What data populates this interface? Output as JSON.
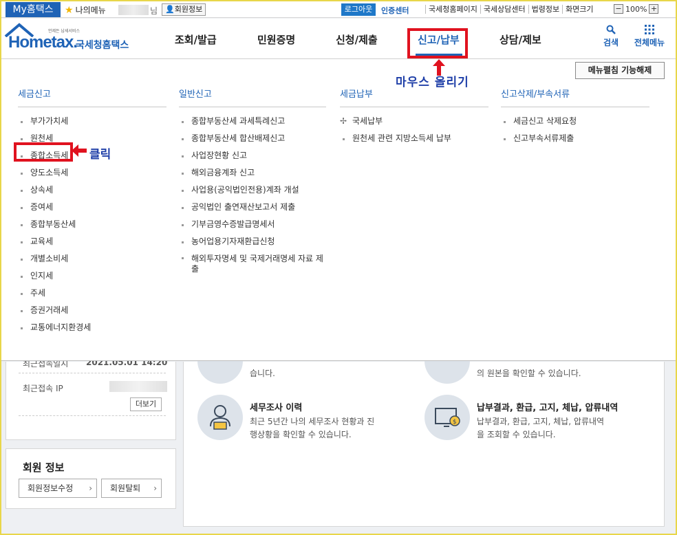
{
  "topbar": {
    "my_label": "My홈택스",
    "my_menu": "나의메뉴",
    "name_suffix": "님",
    "member_info": "회원정보",
    "logout": "로그아웃",
    "cert_center": "인증센터",
    "links": [
      "국세청홈페이지",
      "국세상담센터",
      "법령정보",
      "화면크기"
    ],
    "zoom_minus": "−",
    "zoom_value": "100%",
    "zoom_plus": "+"
  },
  "header": {
    "logo_sub": "언제든 납세서비스",
    "logo_text": "Hometax.",
    "logo_kr": "국세청홈택스",
    "nav": [
      "조회/발급",
      "민원증명",
      "신청/제출",
      "신고/납부",
      "상담/제보"
    ],
    "active_nav": "신고/납부",
    "search_label": "검색",
    "all_menu_label": "전체메뉴"
  },
  "mega": {
    "fold_button": "메뉴펼침 기능해제",
    "columns": [
      {
        "title": "세금신고",
        "items": [
          "부가가치세",
          "원천세",
          "종합소득세",
          "양도소득세",
          "상속세",
          "증여세",
          "종합부동산세",
          "교육세",
          "개별소비세",
          "인지세",
          "주세",
          "증권거래세",
          "교통에너지환경세"
        ]
      },
      {
        "title": "일반신고",
        "items": [
          "종합부동산세 과세특례신고",
          "종합부동산세 합산배제신고",
          "사업장현황 신고",
          "해외금융계좌 신고",
          "사업용(공익법인전용)계좌 개설",
          "공익법인 출연재산보고서 제출",
          "기부금영수증발급명세서",
          "농어업용기자재환급신청",
          "해외투자명세 및 국제거래명세 자료 제출"
        ]
      },
      {
        "title": "세금납부",
        "items": [
          "국세납부",
          "원천세 관련 지방소득세 납부"
        ]
      },
      {
        "title": "신고삭제/부속서류",
        "items": [
          "세금신고 삭제요청",
          "신고부속서류제출"
        ]
      }
    ]
  },
  "annotations": {
    "hover": "마우스 올리기",
    "click": "클릭"
  },
  "leftpanel": {
    "last_login_label": "최근접속일시",
    "last_login_value": "2021.05.01 14:20",
    "last_ip_label": "최근접속 IP",
    "more": "더보기"
  },
  "member_panel": {
    "title": "회원 정보",
    "edit": "회원정보수정",
    "withdraw": "회원탈퇴"
  },
  "rightpanel": {
    "top_left_desc": "습니다.",
    "top_right_desc": "의 원본을 확인할 수 있습니다.",
    "audit_title": "세무조사 이력",
    "audit_desc1": "최근 5년간 나의 세무조사 현황과 진",
    "audit_desc2": "행상황을 확인할 수 있습니다.",
    "pay_title": "납부결과, 환급, 고지, 체납, 압류내역",
    "pay_desc1": "납부결과, 환급, 고지, 체납, 압류내역",
    "pay_desc2": "을 조회할 수 있습니다."
  },
  "colors": {
    "brand": "#1f63b6",
    "annotation_red": "#e0121f",
    "annotation_text": "#1f3fa8"
  }
}
